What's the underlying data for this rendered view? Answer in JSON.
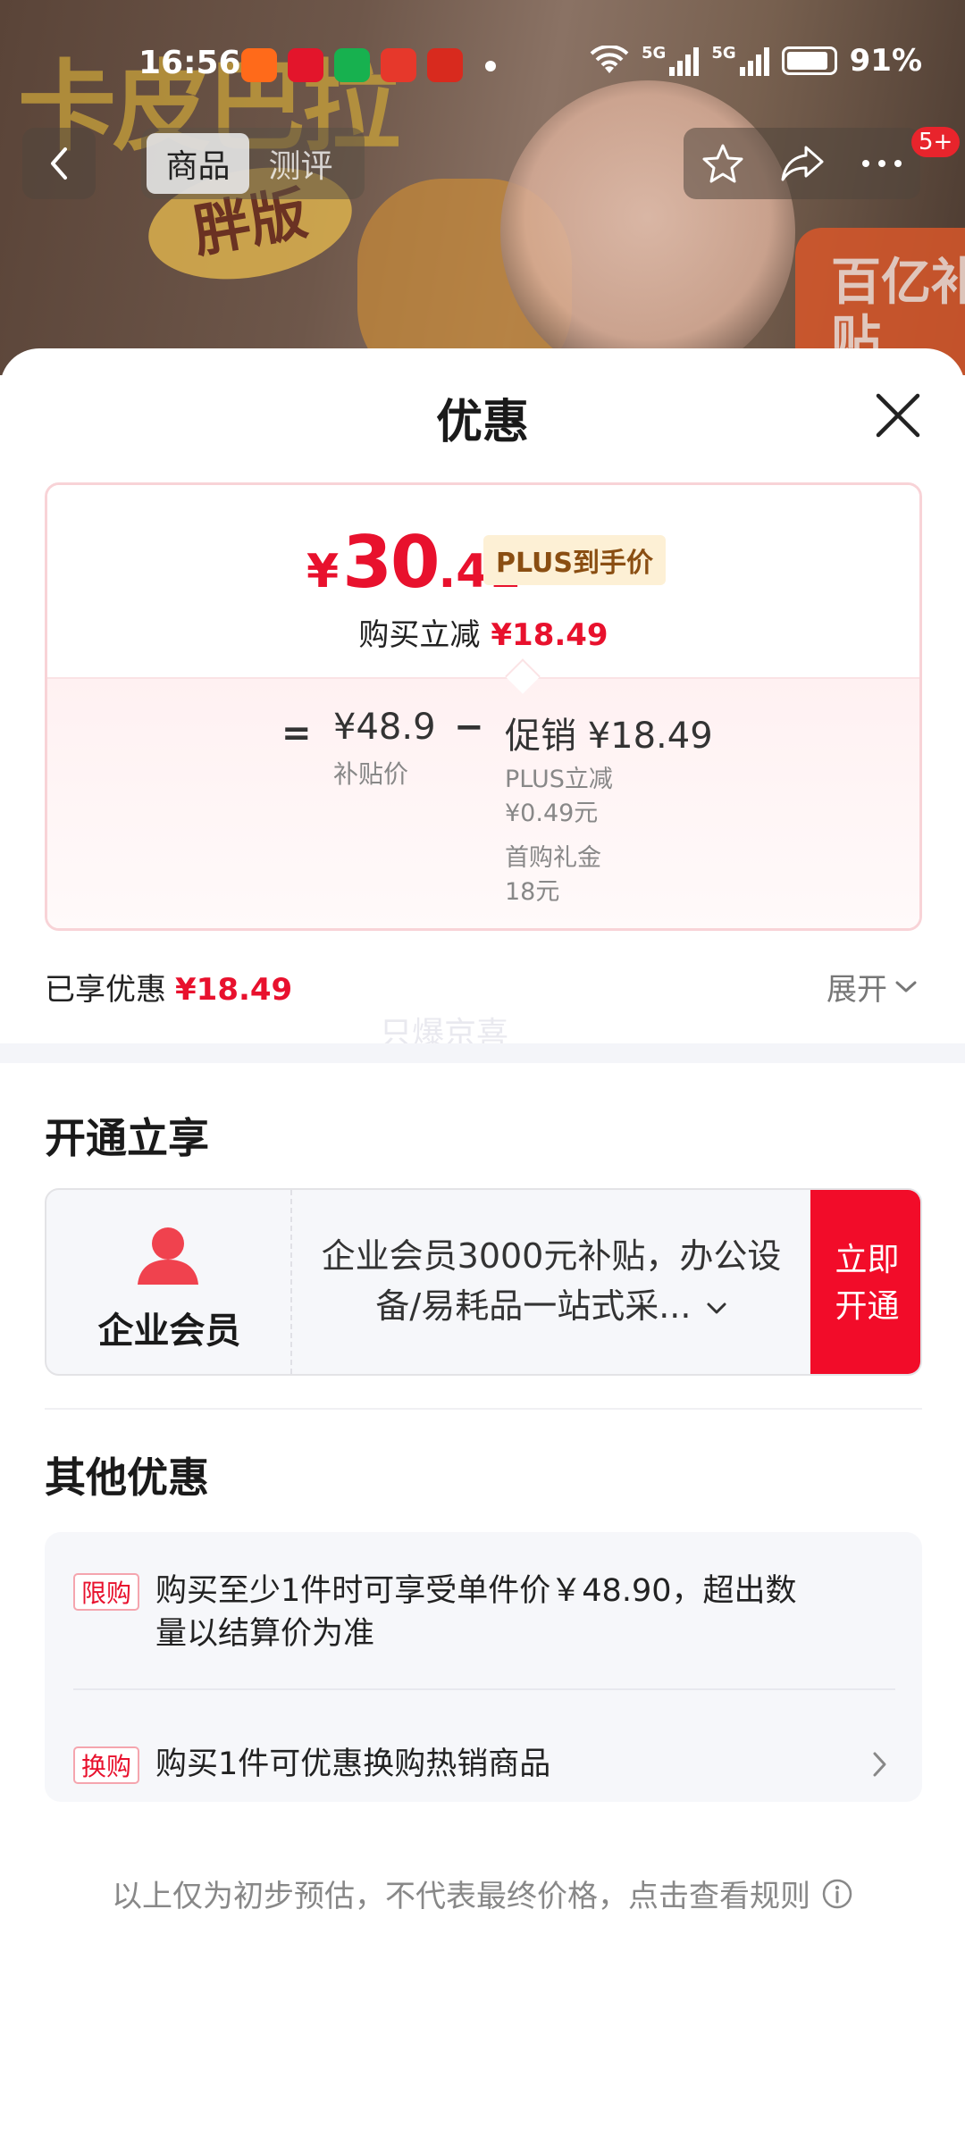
{
  "status_bar": {
    "time": "16:56",
    "network_1": "5G",
    "network_2": "5G",
    "battery": "91%",
    "app_icon_colors": [
      "#ff6a1a",
      "#e3152b",
      "#17b14f",
      "#e6382b",
      "#d82a1e"
    ]
  },
  "background_banner": {
    "title": "卡皮巴拉",
    "badge": "胖版",
    "corner_badge": "百亿补贴"
  },
  "nav": {
    "tabs": [
      {
        "label": "商品",
        "active": true
      },
      {
        "label": "测评",
        "active": false
      }
    ],
    "more_badge": "5+"
  },
  "sheet": {
    "title": "优惠",
    "price": {
      "currency": "¥",
      "integer": "30",
      "decimal": ".41",
      "tag": "PLUS到手价",
      "instant_label": "购买立减",
      "instant_value": "¥18.49"
    },
    "breakdown": {
      "equals": "=",
      "subsidy_price": "¥48.9",
      "subsidy_label": "补贴价",
      "minus": "−",
      "promo_main": "促销 ¥18.49",
      "promo_lines": [
        "PLUS立减",
        "¥0.49元",
        "首购礼金",
        "18元"
      ]
    },
    "enjoyed_label": "已享优惠",
    "enjoyed_value": "¥18.49",
    "expand_label": "展开",
    "watermark": "只爆京喜"
  },
  "open_section": {
    "title": "开通立享",
    "member_name": "企业会员",
    "member_desc": "企业会员3000元补贴，办公设备/易耗品一站式采...",
    "open_button": "立即开通"
  },
  "other_section": {
    "title": "其他优惠",
    "items": [
      {
        "tag": "限购",
        "text": "购买至少1件时可享受单件价￥48.90，超出数量以结算价为准"
      },
      {
        "tag": "换购",
        "text": "购买1件可优惠换购热销商品"
      }
    ]
  },
  "disclaimer": "以上仅为初步预估，不代表最终价格，点击查看规则",
  "colors": {
    "accent_red": "#e8112d",
    "button_red": "#f20c29",
    "plus_tag_bg": "#fdf0d5",
    "plus_tag_text": "#8a4e12"
  }
}
